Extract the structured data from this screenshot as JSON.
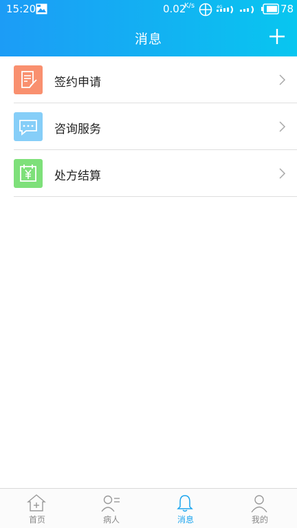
{
  "status_bar": {
    "time": "15:20",
    "net_speed": "0.02",
    "net_speed_unit": "K/s",
    "battery": "78"
  },
  "header": {
    "title": "消息",
    "add_icon": "plus-icon"
  },
  "messages": {
    "items": [
      {
        "label": "签约申请",
        "icon": "document-edit-icon",
        "color": "#f9906f"
      },
      {
        "label": "咨询服务",
        "icon": "chat-bubble-icon",
        "color": "#86cef8"
      },
      {
        "label": "处方结算",
        "icon": "calendar-yuan-icon",
        "color": "#7ee07a"
      }
    ]
  },
  "tabbar": {
    "tabs": [
      {
        "label": "首页",
        "icon": "home-icon"
      },
      {
        "label": "病人",
        "icon": "patients-icon"
      },
      {
        "label": "消息",
        "icon": "bell-icon"
      },
      {
        "label": "我的",
        "icon": "profile-icon"
      }
    ],
    "active_tab": "消息",
    "active_color": "#1aa4ee",
    "inactive_color": "#888888"
  },
  "colors": {
    "header_gradient_start": "#1c9cf6",
    "header_gradient_end": "#08c6f0"
  }
}
